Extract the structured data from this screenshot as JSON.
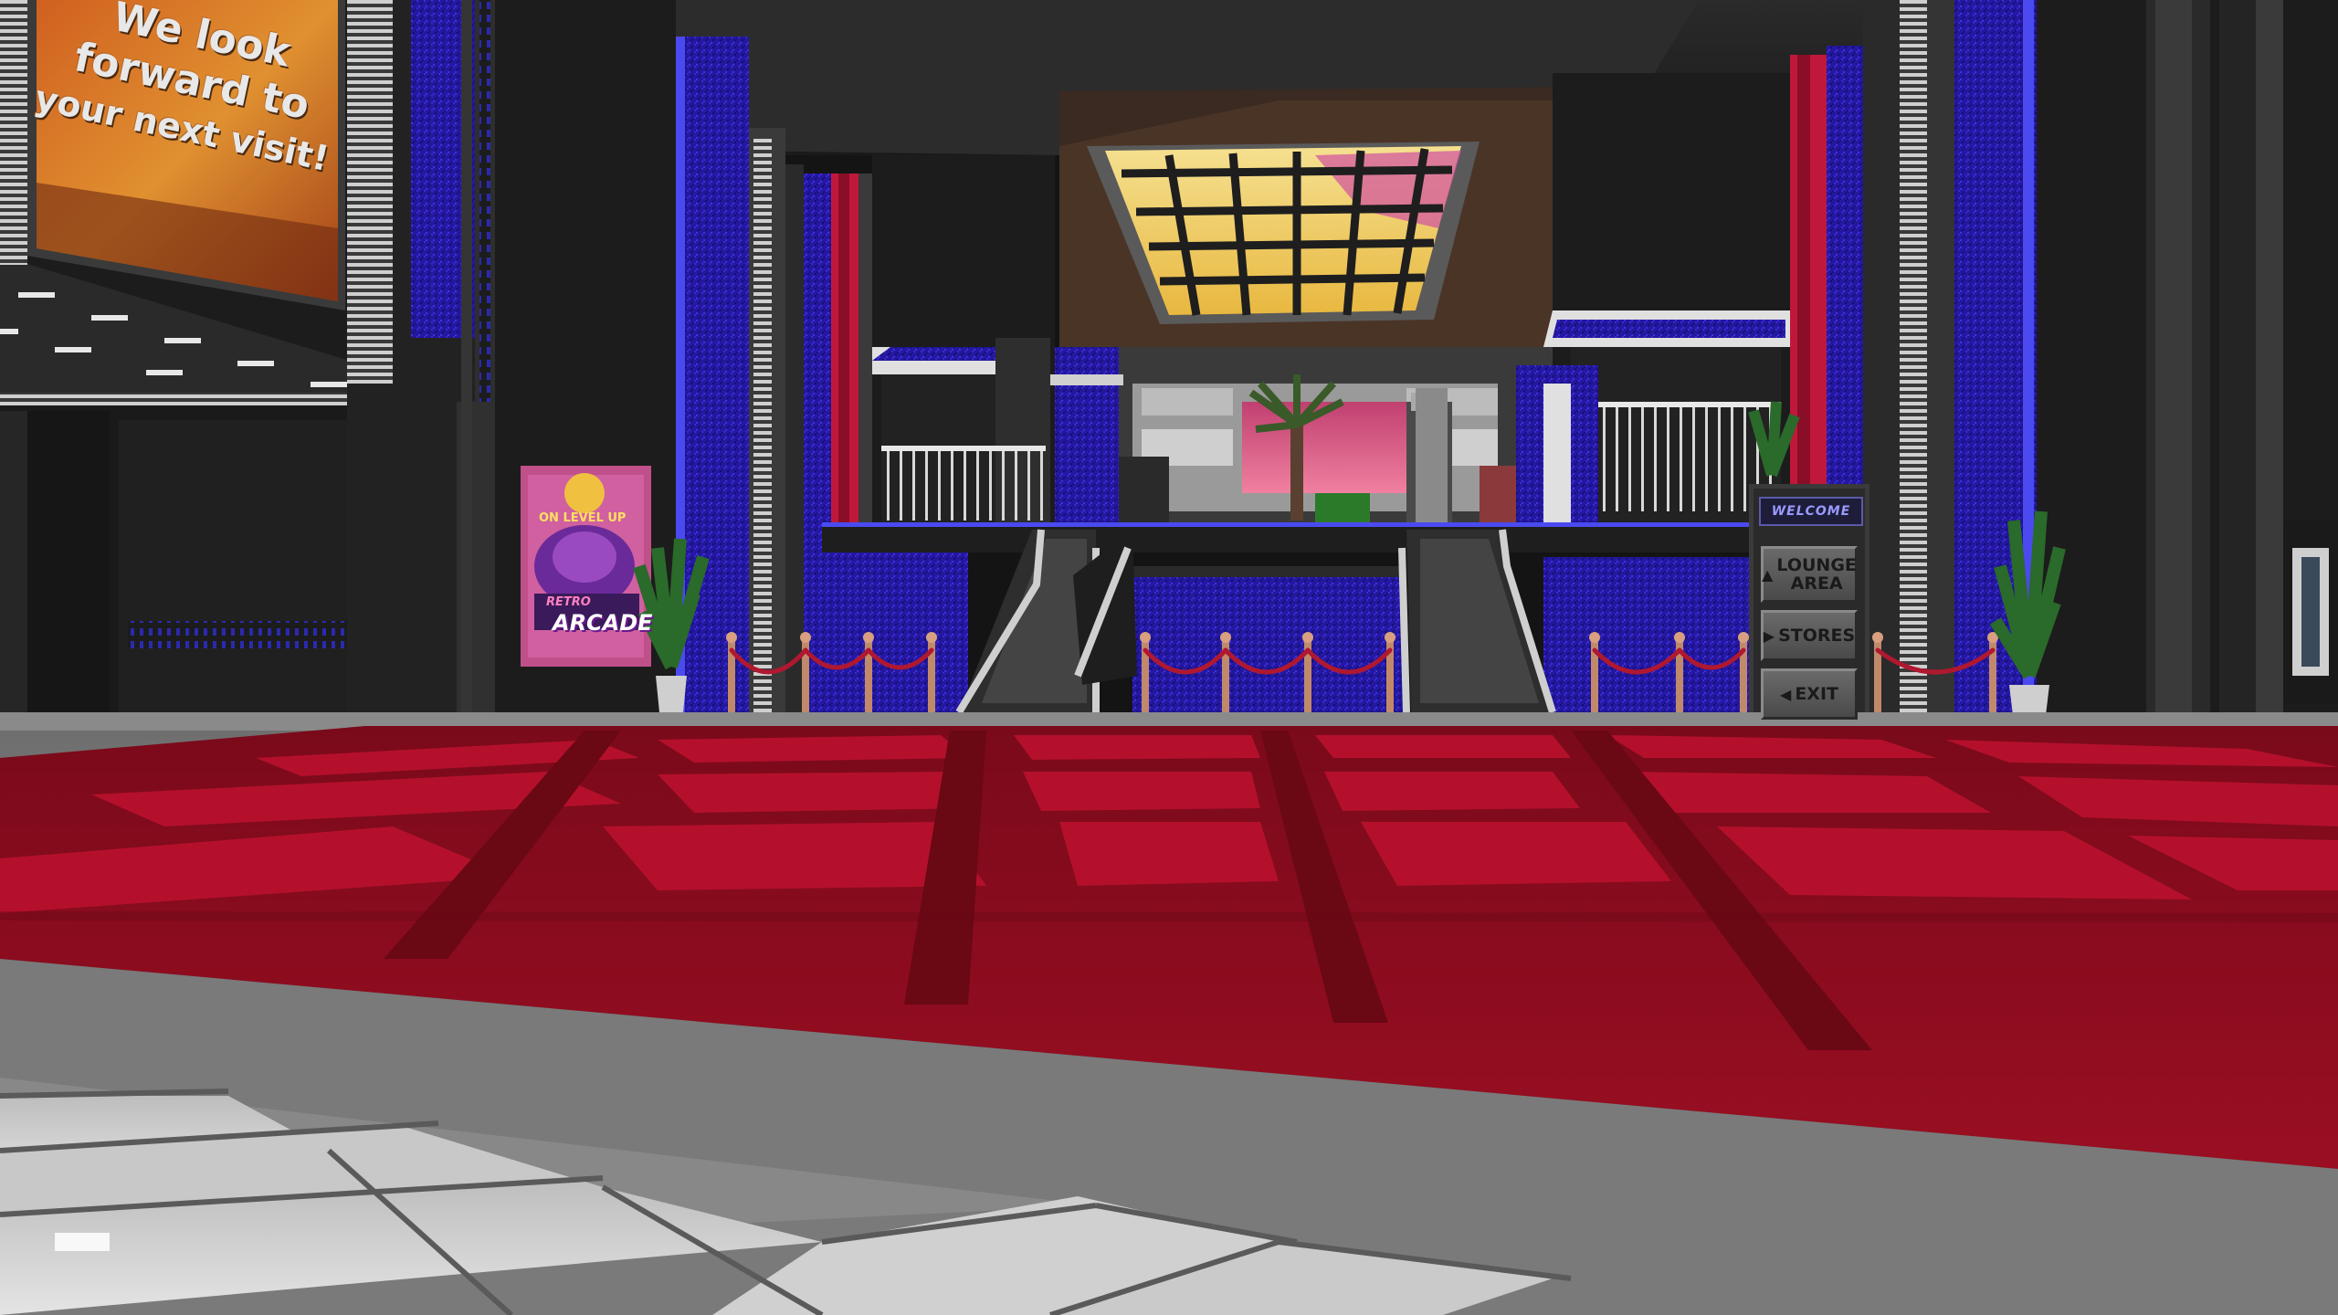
{
  "scene": {
    "billboard": {
      "lines": [
        "We look",
        "forward to",
        "your next visit!"
      ]
    },
    "arcade_poster": {
      "top_text": "ON LEVEL UP",
      "brand": "RETRO",
      "title": "ARCADE"
    },
    "directory_sign": {
      "header": "WELCOME",
      "items": [
        {
          "label_line1": "LOUNGE",
          "label_line2": "AREA",
          "arrow": "▲"
        },
        {
          "label_line1": "STORES",
          "label_line2": "",
          "arrow": "▶"
        },
        {
          "label_line1": "EXIT",
          "label_line2": "",
          "arrow": "◀"
        }
      ]
    },
    "colors": {
      "carpet": "#8a0a1e",
      "carpet_tile": "#b0102c",
      "neon_blue": "#2a1aa8",
      "accent_red": "#c0183a",
      "wall": "#1e1e1e",
      "skylight": "#f0d060"
    }
  }
}
